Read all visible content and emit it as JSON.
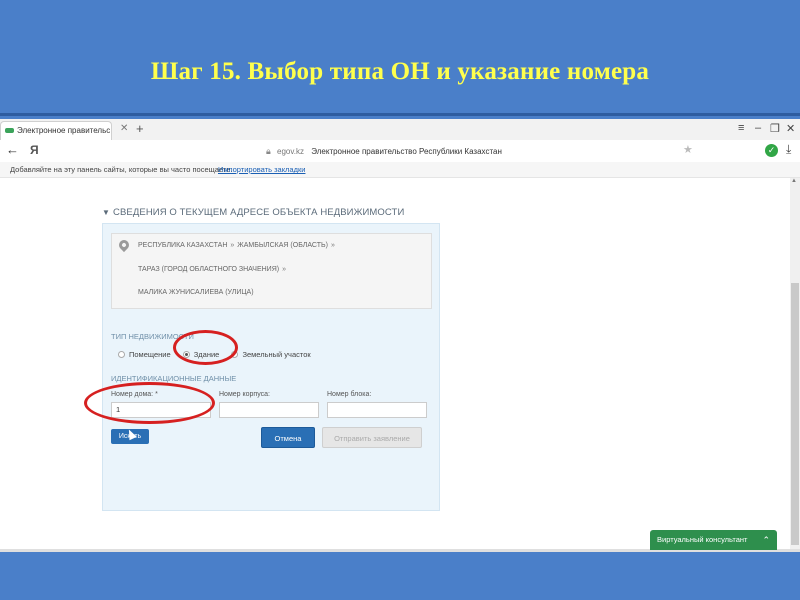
{
  "slide": {
    "title": "Шаг 15. Выбор типа ОН и указание номера"
  },
  "browser": {
    "tab_title": "Электронное правительс",
    "url_domain": "egov.kz",
    "url_title": "Электронное правительство Республики Казахстан",
    "yandex_label": "Я",
    "bookmarks_text": "Добавляйте на эту панель сайты, которые вы часто посещаете.",
    "bookmarks_link": "Импортировать закладки"
  },
  "form": {
    "section_title": "СВЕДЕНИЯ О ТЕКУЩЕМ АДРЕСЕ ОБЪЕКТА НЕДВИЖИМОСТИ",
    "address": {
      "line1_a": "РЕСПУБЛИКА КАЗАХСТАН",
      "line1_b": "ЖАМБЫЛСКАЯ (ОБЛАСТЬ)",
      "line2": "ТАРАЗ (ГОРОД ОБЛАСТНОГО ЗНАЧЕНИЯ)",
      "line3": "МАЛИКА ЖУНИСАЛИЕВА (УЛИЦА)",
      "separator": "»"
    },
    "property_type_label": "ТИП НЕДВИЖИМОСТИ",
    "property_types": [
      {
        "label": "Помещение",
        "selected": false
      },
      {
        "label": "Здание",
        "selected": true
      },
      {
        "label": "Земельный участок",
        "selected": false
      }
    ],
    "ident_label": "ИДЕНТИФИКАЦИОННЫЕ ДАННЫЕ",
    "house_label": "Номер дома: *",
    "house_value": "1",
    "building_label": "Номер корпуса:",
    "building_value": "",
    "block_label": "Номер блока:",
    "block_value": "",
    "find_button": "Искать"
  },
  "actions": {
    "cancel": "Отмена",
    "submit": "Отправить заявление"
  },
  "consultant": {
    "label": "Виртуальный консультант"
  },
  "colors": {
    "slide_bg": "#4a7fc9",
    "title": "#ffff4d",
    "primary_button": "#2a6fb5",
    "consultant": "#2e8f4d",
    "highlight": "#d62020"
  }
}
